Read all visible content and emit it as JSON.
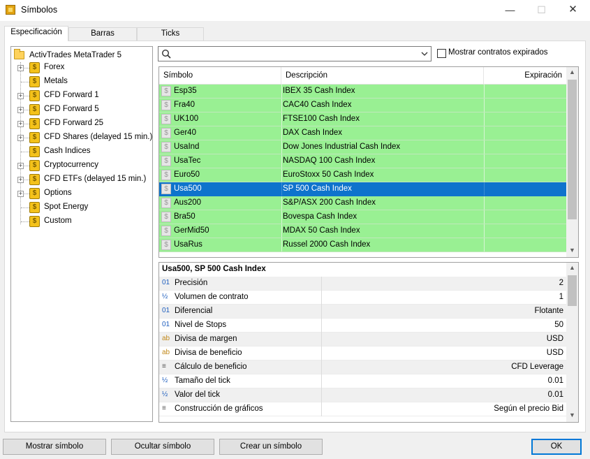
{
  "window": {
    "title": "Símbolos",
    "minimize_glyph": "—",
    "maximize_glyph": "☐",
    "close_glyph": "✕"
  },
  "tabs": [
    {
      "label": "Especificación",
      "active": true
    },
    {
      "label": "Barras",
      "active": false
    },
    {
      "label": "Ticks",
      "active": false
    }
  ],
  "tree": {
    "root_label": "ActivTrades MetaTrader 5",
    "items": [
      {
        "label": "Forex",
        "expandable": true
      },
      {
        "label": "Metals",
        "expandable": false
      },
      {
        "label": "CFD Forward 1",
        "expandable": true
      },
      {
        "label": "CFD Forward 5",
        "expandable": true
      },
      {
        "label": "CFD Forward 25",
        "expandable": true
      },
      {
        "label": "CFD Shares (delayed 15 min.)",
        "expandable": true
      },
      {
        "label": "Cash Indices",
        "expandable": false
      },
      {
        "label": "Cryptocurrency",
        "expandable": true
      },
      {
        "label": "CFD ETFs (delayed 15 min.)",
        "expandable": true
      },
      {
        "label": "Options",
        "expandable": true
      },
      {
        "label": "Spot Energy",
        "expandable": false
      },
      {
        "label": "Custom",
        "expandable": false
      }
    ]
  },
  "search": {
    "value": "",
    "placeholder": ""
  },
  "expired_checkbox": {
    "label": "Mostrar contratos expirados",
    "checked": false
  },
  "symbol_table": {
    "headers": {
      "symbol": "Símbolo",
      "description": "Descripción",
      "expiration": "Expiración"
    },
    "rows": [
      {
        "symbol": "Esp35",
        "description": "IBEX 35 Cash Index",
        "expiration": "",
        "selected": false
      },
      {
        "symbol": "Fra40",
        "description": "CAC40 Cash Index",
        "expiration": "",
        "selected": false
      },
      {
        "symbol": "UK100",
        "description": "FTSE100 Cash Index",
        "expiration": "",
        "selected": false
      },
      {
        "symbol": "Ger40",
        "description": "DAX Cash Index",
        "expiration": "",
        "selected": false
      },
      {
        "symbol": "UsaInd",
        "description": "Dow Jones Industrial Cash Index",
        "expiration": "",
        "selected": false
      },
      {
        "symbol": "UsaTec",
        "description": "NASDAQ 100 Cash Index",
        "expiration": "",
        "selected": false
      },
      {
        "symbol": "Euro50",
        "description": "EuroStoxx 50 Cash Index",
        "expiration": "",
        "selected": false
      },
      {
        "symbol": "Usa500",
        "description": "SP 500 Cash Index",
        "expiration": "",
        "selected": true
      },
      {
        "symbol": "Aus200",
        "description": "S&P/ASX 200 Cash Index",
        "expiration": "",
        "selected": false
      },
      {
        "symbol": "Bra50",
        "description": "Bovespa Cash Index",
        "expiration": "",
        "selected": false
      },
      {
        "symbol": "GerMid50",
        "description": "MDAX 50 Cash Index",
        "expiration": "",
        "selected": false
      },
      {
        "symbol": "UsaRus",
        "description": "Russel 2000 Cash Index",
        "expiration": "",
        "selected": false
      }
    ]
  },
  "details": {
    "title": "Usa500, SP 500 Cash Index",
    "properties": [
      {
        "icon": "01",
        "label": "Precisión",
        "value": "2"
      },
      {
        "icon": "½",
        "label": "Volumen de contrato",
        "value": "1"
      },
      {
        "icon": "01",
        "label": "Diferencial",
        "value": "Flotante"
      },
      {
        "icon": "01",
        "label": "Nivel de Stops",
        "value": "50"
      },
      {
        "icon": "ab",
        "label": "Divisa de margen",
        "value": "USD"
      },
      {
        "icon": "ab",
        "label": "Divisa de beneficio",
        "value": "USD"
      },
      {
        "icon": "≡",
        "label": "Cálculo de beneficio",
        "value": "CFD Leverage"
      },
      {
        "icon": "½",
        "label": "Tamaño del tick",
        "value": "0.01"
      },
      {
        "icon": "½",
        "label": "Valor del tick",
        "value": "0.01"
      },
      {
        "icon": "≡",
        "label": "Construcción de gráficos",
        "value": "Según el precio Bid"
      }
    ]
  },
  "buttons": {
    "show_symbol": "Mostrar símbolo",
    "hide_symbol": "Ocultar símbolo",
    "create_symbol": "Crear un símbolo",
    "ok": "OK"
  },
  "colors": {
    "row_green": "#99f093",
    "row_selected": "#0e73cc",
    "coin_gold": "#f4c21b",
    "ok_border": "#0078d7"
  }
}
